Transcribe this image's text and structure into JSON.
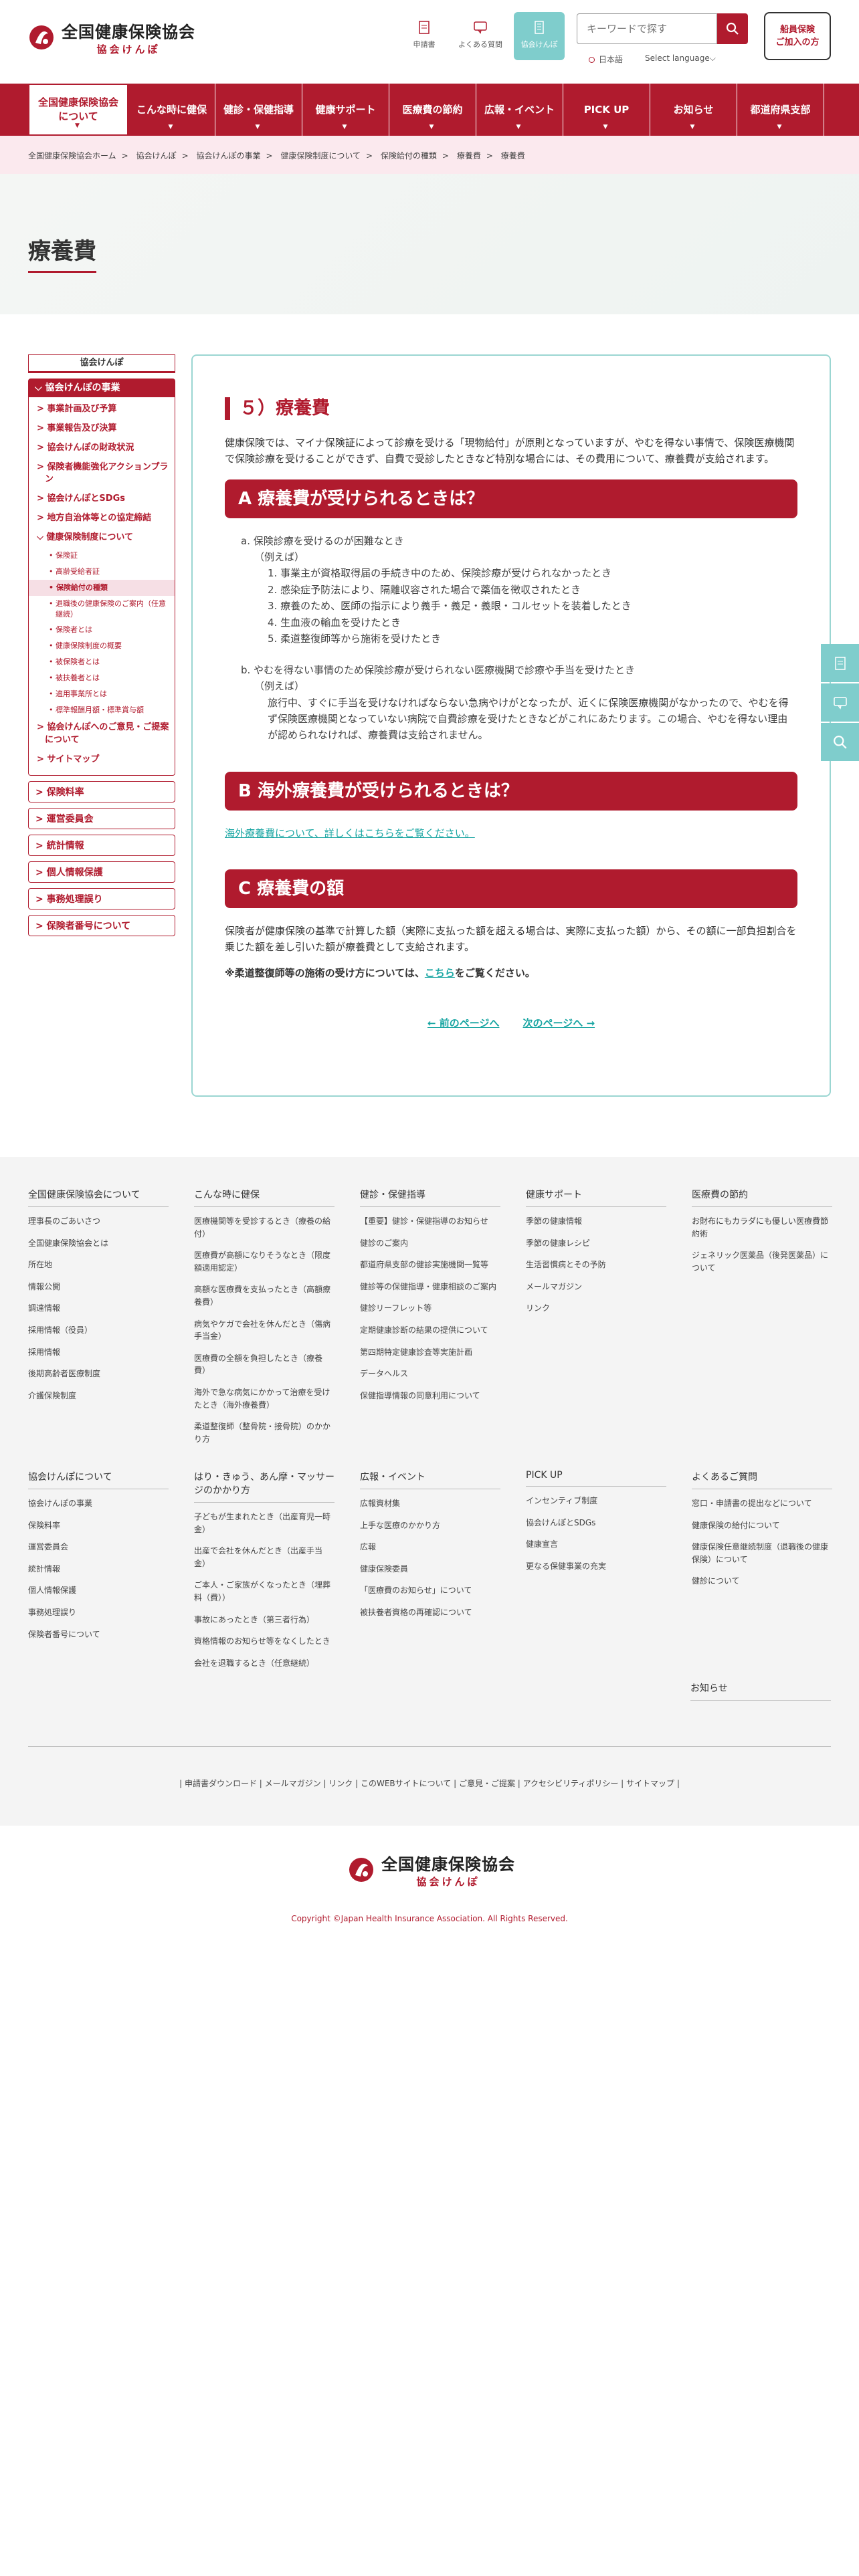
{
  "header": {
    "logo_name": "全国健康保険協会",
    "logo_sub": "協会けんぽ",
    "icons": [
      {
        "label": "申請書",
        "icon": "document-icon"
      },
      {
        "label": "よくある質問",
        "icon": "chat-icon"
      },
      {
        "label": "協会けんぽ",
        "icon": "building-icon"
      }
    ],
    "search_placeholder": "キーワードで探す",
    "lang_jp": "日本語",
    "lang_select": "Select language⌵",
    "join_button": [
      "船員保険",
      "ご加入の方"
    ]
  },
  "nav": [
    "全国健康保険協会について",
    "こんな時に健保",
    "健診・保健指導",
    "健康サポート",
    "医療費の節約",
    "広報・イベント",
    "PICK UP",
    "お知らせ",
    "都道府県支部"
  ],
  "breadcrumb": [
    "全国健康保険協会ホーム",
    "協会けんぽ",
    "協会けんぽの事業",
    "健康保険制度について",
    "保険給付の種類",
    "療養費",
    "療養費"
  ],
  "page_title": "療養費",
  "sidebar": {
    "head": "協会けんぽ",
    "section": "協会けんぽの事業",
    "items": [
      {
        "level": 1,
        "label": "事業計画及び予算"
      },
      {
        "level": 1,
        "label": "事業報告及び決算"
      },
      {
        "level": 1,
        "label": "協会けんぽの財政状況"
      },
      {
        "level": 1,
        "label": "保険者機能強化アクションプラン"
      },
      {
        "level": 1,
        "label": "協会けんぽとSDGs"
      },
      {
        "level": 1,
        "label": "地方自治体等との協定締結"
      },
      {
        "level": 1,
        "label": "健康保険制度について"
      },
      {
        "level": 2,
        "label": "保険証"
      },
      {
        "level": 2,
        "label": "高齢受給者証"
      },
      {
        "level": 2,
        "label": "保険給付の種類",
        "current": true
      },
      {
        "level": 2,
        "label": "退職後の健康保険のご案内（任意継続）"
      },
      {
        "level": 2,
        "label": "保険者とは"
      },
      {
        "level": 2,
        "label": "健康保険制度の概要"
      },
      {
        "level": 2,
        "label": "被保険者とは"
      },
      {
        "level": 2,
        "label": "被扶養者とは"
      },
      {
        "level": 2,
        "label": "適用事業所とは"
      },
      {
        "level": 2,
        "label": "標準報酬月額・標準賞与額"
      },
      {
        "level": 1,
        "label": "協会けんぽへのご意見・ご提案について"
      },
      {
        "level": 1,
        "label": "サイトマップ"
      }
    ],
    "solos": [
      "保険料率",
      "運営委員会",
      "統計情報",
      "個人情報保護",
      "事務処理誤り",
      "保険者番号について"
    ]
  },
  "content": {
    "h2": "５）療養費",
    "intro": "健康保険では、マイナ保険証によって診療を受ける「現物給付」が原則となっていますが、やむを得ない事情で、保険医療機関で保険診療を受けることができず、自費で受診したときなど特別な場合には、その費用について、療養費が支給されます。",
    "sec_a_title": "A 療養費が受けられるときは？",
    "a_head": "a. 保険診療を受けるのが困難なとき",
    "a_ex": "（例えば）",
    "a_items": [
      "1. 事業主が資格取得届の手続き中のため、保険診療が受けられなかったとき",
      "2. 感染症予防法により、隔離収容された場合で薬価を徴収されたとき",
      "3. 療養のため、医師の指示により義手・義足・義眼・コルセットを装着したとき",
      "4. 生血液の輸血を受けたとき",
      "5. 柔道整復師等から施術を受けたとき"
    ],
    "b_head": "b. やむを得ない事情のため保険診療が受けられない医療機関で診療や手当を受けたとき",
    "b_ex": "（例えば）",
    "b_text": "旅行中、すぐに手当を受けなければならない急病やけがとなったが、近くに保険医療機関がなかったので、やむを得ず保険医療機関となっていない病院で自費診療を受けたときなどがこれにあたります。この場合、やむを得ない理由が認められなければ、療養費は支給されません。",
    "sec_b_title": "B 海外療養費が受けられるときは？",
    "sec_b_link": "海外療養費について、詳しくはこちらをご覧ください。",
    "sec_c_title": "C 療養費の額",
    "c_text": "保険者が健康保険の基準で計算した額（実際に支払った額を超える場合は、実際に支払った額）から、その額に一部負担割合を乗じた額を差し引いた額が療養費として支給されます。",
    "c_note_pre": "※柔道整復師等の施術の受け方については、",
    "c_note_link": "こちら",
    "c_note_post": "をご覧ください。",
    "prev": "← 前のページへ",
    "next": "次のページへ →"
  },
  "footer": {
    "row1": [
      {
        "head": "全国健康保険協会について",
        "items": [
          "理事長のごあいさつ",
          "全国健康保険協会とは",
          "所在地",
          "情報公開",
          "調達情報",
          "採用情報（役員）",
          "採用情報",
          "後期高齢者医療制度",
          "介護保険制度"
        ]
      },
      {
        "head": "こんな時に健保",
        "items": [
          "医療機関等を受診するとき（療養の給付）",
          "医療費が高額になりそうなとき（限度額適用認定）",
          "高額な医療費を支払ったとき（高額療養費）",
          "病気やケガで会社を休んだとき（傷病手当金）",
          "医療費の全額を負担したとき（療養費）",
          "海外で急な病気にかかって治療を受けたとき（海外療養費）",
          "柔道整復師（整骨院・接骨院）のかかり方"
        ]
      },
      {
        "head": "健診・保健指導",
        "items": [
          "【重要】健診・保健指導のお知らせ",
          "健診のご案内",
          "都道府県支部の健診実施機関一覧等",
          "健診等の保健指導・健康相談のご案内",
          "健診リーフレット等",
          "定期健康診断の結果の提供について",
          "第四期特定健康診査等実施計画",
          "データヘルス",
          "保健指導情報の同意利用について"
        ]
      },
      {
        "head": "健康サポート",
        "items": [
          "季節の健康情報",
          "季節の健康レシピ",
          "生活習慣病とその予防",
          "メールマガジン",
          "リンク"
        ]
      },
      {
        "head": "医療費の節約",
        "items": [
          "お財布にもカラダにも優しい医療費節約術",
          "ジェネリック医薬品（後発医薬品）について"
        ]
      }
    ],
    "row2": [
      {
        "head": "協会けんぽについて",
        "items": [
          "協会けんぽの事業",
          "保険料率",
          "運営委員会",
          "統計情報",
          "個人情報保護",
          "事務処理誤り",
          "保険者番号について"
        ]
      },
      {
        "head": "はり・きゅう、あん摩・マッサージのかかり方",
        "items": [
          "子どもが生まれたとき（出産育児一時金）",
          "出産で会社を休んだとき（出産手当金）",
          "ご本人・ご家族がくなったとき（埋葬料（費））",
          "事故にあったとき（第三者行為）",
          "資格情報のお知らせ等をなくしたとき",
          "会社を退職するとき（任意継続）"
        ]
      },
      {
        "head": "広報・イベント",
        "items": [
          "広報資材集",
          "上手な医療のかかり方",
          "広報",
          "健康保険委員",
          "「医療費のお知らせ」について",
          "被扶養者資格の再確認について"
        ]
      },
      {
        "head": "PICK UP",
        "items": [
          "インセンティブ制度",
          "協会けんぽとSDGs",
          "健康宣言",
          "更なる保健事業の充実"
        ]
      },
      {
        "head": "よくあるご質問",
        "items": [
          "窓口・申請書の提出などについて",
          "健康保険の給付について",
          "健康保険任意継続制度（退職後の健康保険）について",
          "健診について"
        ]
      }
    ],
    "extra_head": "お知らせ",
    "bottom_links": "| 申請書ダウンロード | メールマガジン | リンク | このWEBサイトについて | ご意見・ご提案 | アクセシビリティポリシー | サイトマップ |",
    "copyright": "Copyright ©Japan Health Insurance Association. All Rights Reserved."
  },
  "colors": {
    "brand": "#b01b2e",
    "teal": "#7fcdcc",
    "link": "#1aa6a3"
  }
}
